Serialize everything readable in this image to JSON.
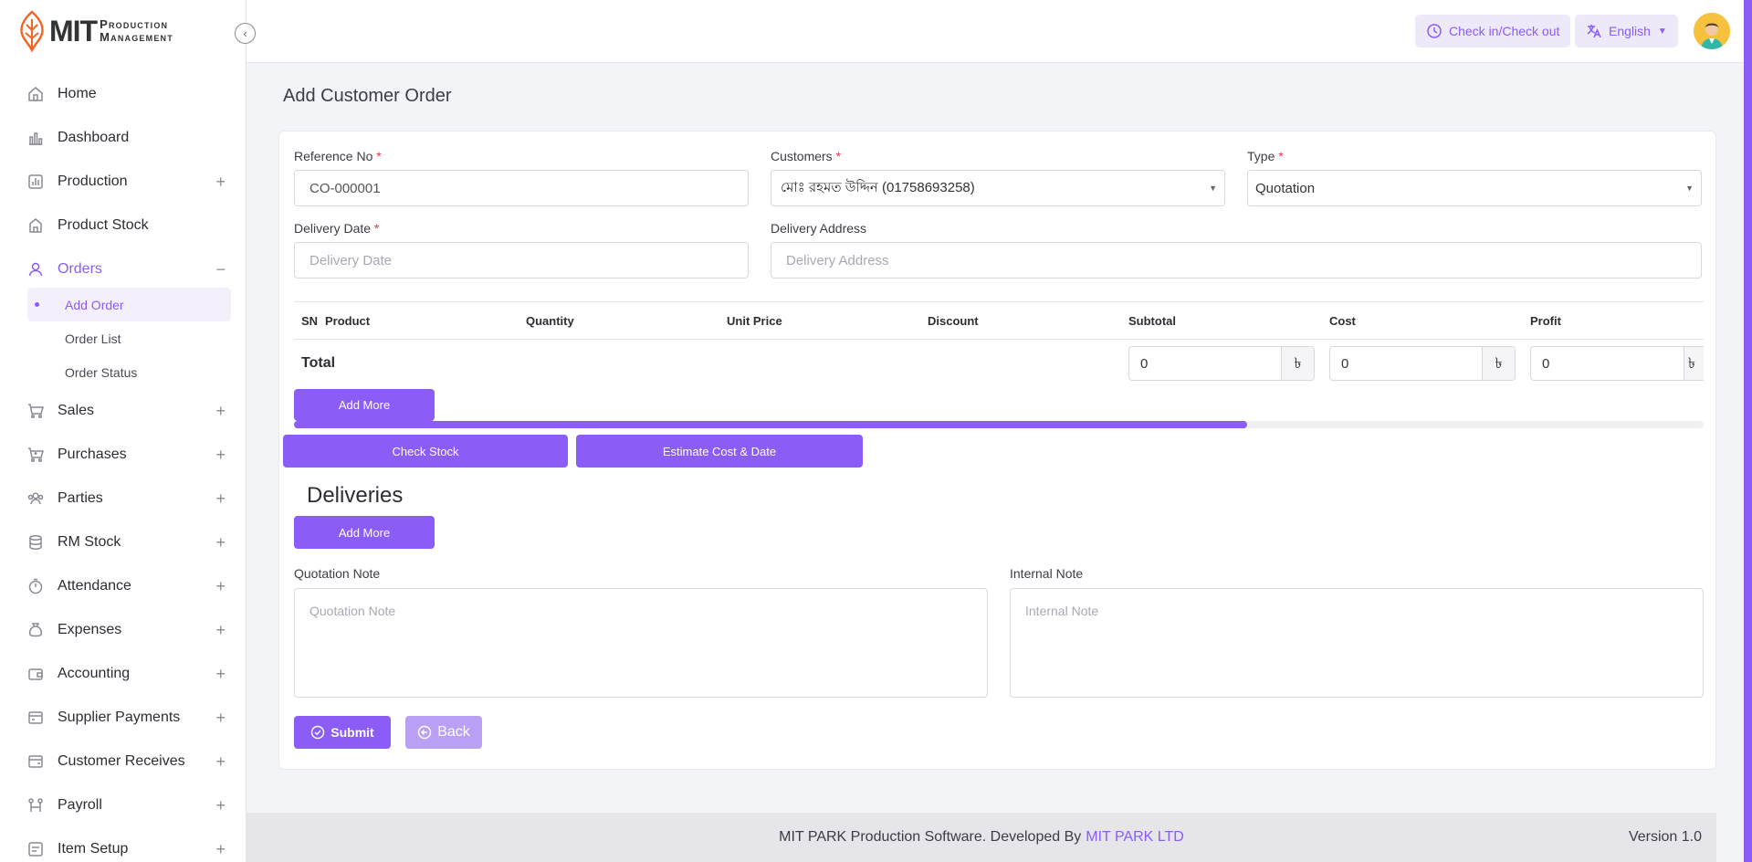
{
  "brand": {
    "mit": "MIT",
    "line1": "Production",
    "line2": "Management"
  },
  "header": {
    "check_in_label": "Check in/Check out",
    "language_label": "English"
  },
  "sidebar": {
    "items": [
      {
        "label": "Home",
        "icon": "home-icon"
      },
      {
        "label": "Dashboard",
        "icon": "chart-icon"
      },
      {
        "label": "Production",
        "icon": "bar-chart-icon"
      },
      {
        "label": "Product Stock",
        "icon": "stock-icon"
      },
      {
        "label": "Orders",
        "icon": "user-icon"
      },
      {
        "label": "Sales",
        "icon": "cart-icon"
      },
      {
        "label": "Purchases",
        "icon": "cart-icon"
      },
      {
        "label": "Parties",
        "icon": "users-icon"
      },
      {
        "label": "RM Stock",
        "icon": "database-icon"
      },
      {
        "label": "Attendance",
        "icon": "stopwatch-icon"
      },
      {
        "label": "Expenses",
        "icon": "money-bag-icon"
      },
      {
        "label": "Accounting",
        "icon": "wallet-icon"
      },
      {
        "label": "Supplier Payments",
        "icon": "payment-icon"
      },
      {
        "label": "Customer Receives",
        "icon": "receive-icon"
      },
      {
        "label": "Payroll",
        "icon": "payroll-icon"
      },
      {
        "label": "Item Setup",
        "icon": "setup-icon"
      }
    ],
    "orders_sub": [
      "Add Order",
      "Order List",
      "Order Status"
    ]
  },
  "page": {
    "title": "Add Customer Order"
  },
  "form": {
    "reference_label": "Reference No",
    "reference_value": "CO-000001",
    "customers_label": "Customers",
    "customers_value": "মোঃ রহমত উদ্দিন (01758693258)",
    "type_label": "Type",
    "type_value": "Quotation",
    "delivery_date_label": "Delivery Date",
    "delivery_date_placeholder": "Delivery Date",
    "delivery_address_label": "Delivery Address",
    "delivery_address_placeholder": "Delivery Address",
    "required_mark": "*"
  },
  "table": {
    "columns": [
      "SN",
      "Product",
      "Quantity",
      "Unit Price",
      "Discount",
      "Subtotal",
      "Cost",
      "Profit"
    ],
    "total_label": "Total",
    "subtotal": "0",
    "cost": "0",
    "profit": "0",
    "currency": "৳"
  },
  "buttons": {
    "add_more": "Add More",
    "check_stock": "Check Stock",
    "estimate": "Estimate Cost & Date",
    "submit": "Submit",
    "back": "Back"
  },
  "deliveries": {
    "title": "Deliveries"
  },
  "notes": {
    "quotation_label": "Quotation Note",
    "quotation_placeholder": "Quotation Note",
    "internal_label": "Internal Note",
    "internal_placeholder": "Internal Note"
  },
  "footer": {
    "text": "MIT PARK Production Software. Developed By",
    "link": "MIT PARK LTD",
    "version": "Version 1.0"
  },
  "colors": {
    "accent": "#8b5cf6",
    "required": "#e0364c",
    "logo": "#f26522"
  }
}
